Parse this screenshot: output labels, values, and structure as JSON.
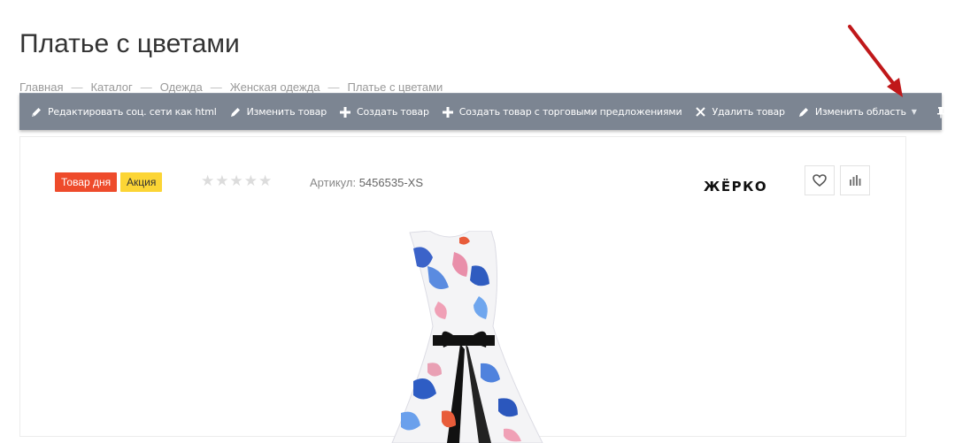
{
  "page": {
    "title": "Платье с цветами"
  },
  "breadcrumb": [
    "Главная",
    "Каталог",
    "Одежда",
    "Женская одежда",
    "Платье с цветами"
  ],
  "breadcrumb_separator": "—",
  "toolbar": {
    "edit_social": "Редактировать соц. сети как html",
    "edit_product": "Изменить товар",
    "create_product": "Создать товар",
    "create_product_offers": "Создать товар с торговыми предложениями",
    "delete_product": "Удалить товар",
    "edit_area": "Изменить область",
    "pin_icon": "pin-icon",
    "settings_icon": "gear-icon"
  },
  "product": {
    "badge_day": "Товар дня",
    "badge_sale": "Акция",
    "rating_stars": 0,
    "rating_max": 5,
    "article_label": "Артикул:",
    "article_value": "5456535-XS",
    "brand": "ЖЁРКО"
  },
  "colors": {
    "toolbar_bg": "#7c8592",
    "badge_day": "#ee4b2b",
    "badge_sale": "#fcd535",
    "arrow": "#c0181a"
  }
}
